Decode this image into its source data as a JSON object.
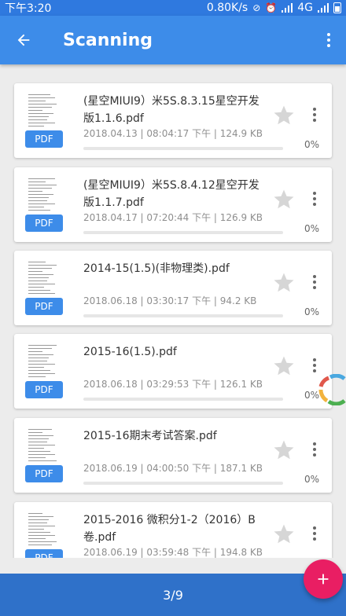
{
  "status_bar": {
    "time": "下午3:20",
    "speed": "0.80K/s",
    "network": "4G"
  },
  "app_bar": {
    "title": "Scanning"
  },
  "files": [
    {
      "name": "(星空MIUI9）米5S.8.3.15星空开发版1.1.6.pdf",
      "meta": "2018.04.13 | 08:04:17 下午 | 124.9 KB",
      "progress_text": "0%",
      "progress": 0,
      "badge": "PDF"
    },
    {
      "name": "(星空MIUI9）米5S.8.4.12星空开发版1.1.7.pdf",
      "meta": "2018.04.17 | 07:20:44 下午 | 126.9 KB",
      "progress_text": "0%",
      "progress": 0,
      "badge": "PDF"
    },
    {
      "name": "2014-15(1.5)(非物理类).pdf",
      "meta": "2018.06.18 | 03:30:17 下午 | 94.2 KB",
      "progress_text": "0%",
      "progress": 0,
      "badge": "PDF"
    },
    {
      "name": "2015-16(1.5).pdf",
      "meta": "2018.06.18 | 03:29:53 下午 | 126.1 KB",
      "progress_text": "0%",
      "progress": 0,
      "badge": "PDF"
    },
    {
      "name": "2015-16期末考试答案.pdf",
      "meta": "2018.06.19 | 04:00:50 下午 | 187.1 KB",
      "progress_text": "0%",
      "progress": 0,
      "badge": "PDF"
    },
    {
      "name": "2015-2016 微积分1-2（2016）B卷.pdf",
      "meta": "2018.06.19 | 03:59:48 下午 | 194.8 KB",
      "progress_text": "",
      "progress": 0,
      "badge": "PDF"
    }
  ],
  "pagination": {
    "label": "3/9"
  },
  "fab": {
    "label": "+"
  },
  "colors": {
    "primary": "#3d8ce9",
    "status_bar": "#2f79df",
    "bottom_bar": "#2f71c9",
    "fab": "#e91e63"
  },
  "icons": [
    "back-arrow-icon",
    "more-vert-icon",
    "star-icon",
    "pdf-badge",
    "add-icon",
    "loading-spinner-icon"
  ]
}
